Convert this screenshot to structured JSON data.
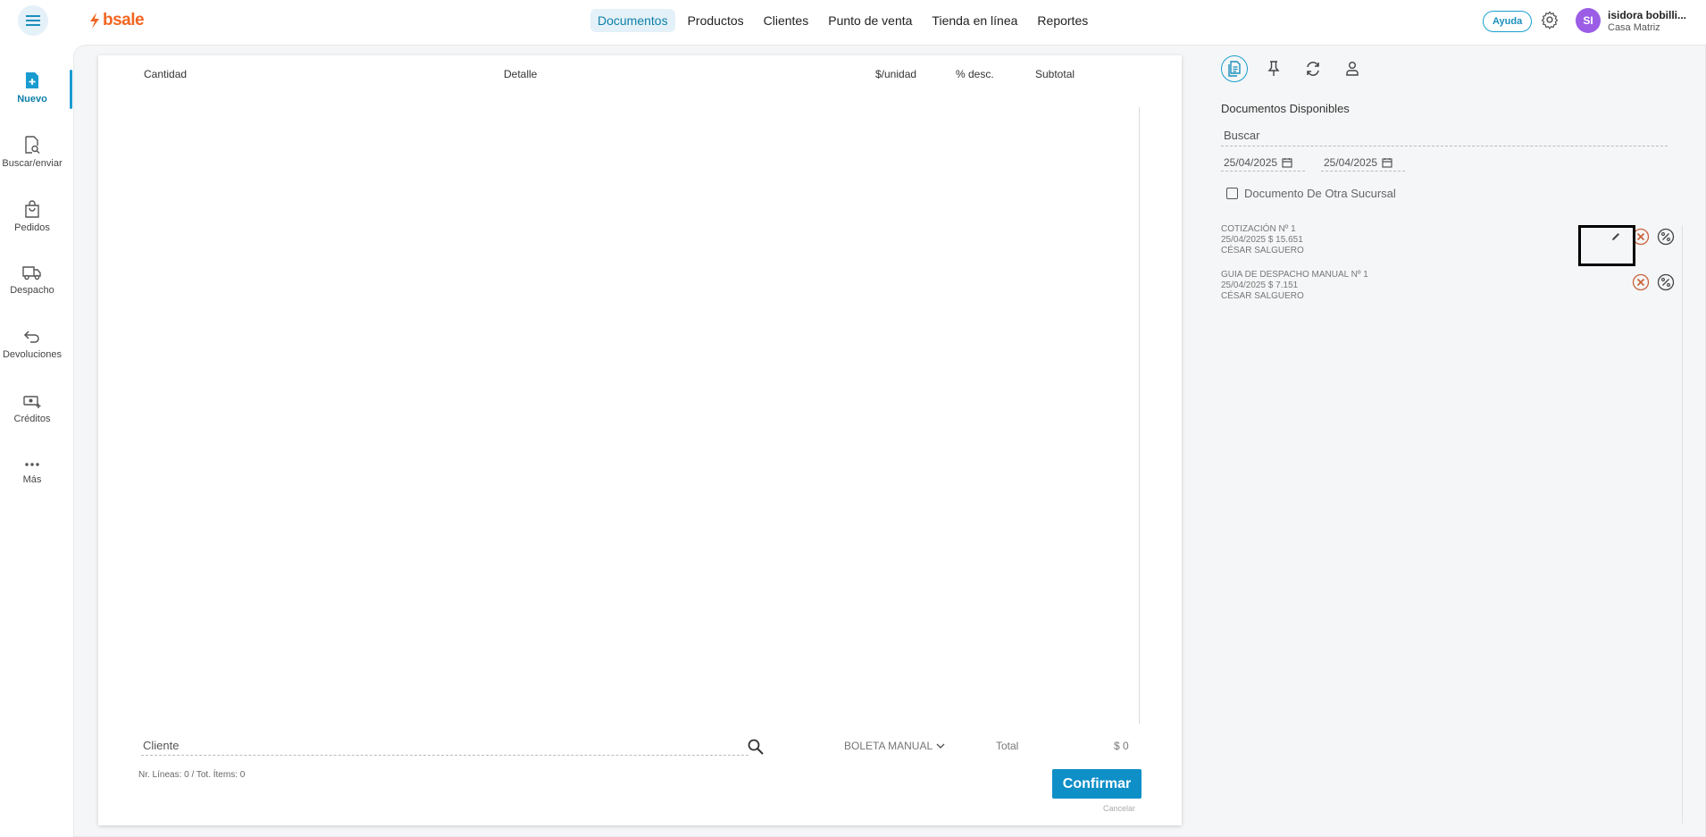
{
  "header": {
    "logo_text": "bsale",
    "nav": [
      {
        "label": "Documentos",
        "active": true
      },
      {
        "label": "Productos",
        "active": false
      },
      {
        "label": "Clientes",
        "active": false
      },
      {
        "label": "Punto de venta",
        "active": false
      },
      {
        "label": "Tienda en línea",
        "active": false
      },
      {
        "label": "Reportes",
        "active": false
      }
    ],
    "help_label": "Ayuda",
    "avatar_initials": "SI",
    "user_name": "isidora bobilli...",
    "user_branch": "Casa Matriz"
  },
  "sidebar": {
    "items": [
      {
        "label": "Nuevo",
        "icon": "new-document-icon",
        "active": true
      },
      {
        "label": "Buscar/enviar",
        "icon": "search-document-icon",
        "active": false
      },
      {
        "label": "Pedidos",
        "icon": "shopping-bag-icon",
        "active": false
      },
      {
        "label": "Despacho",
        "icon": "truck-icon",
        "active": false
      },
      {
        "label": "Devoluciones",
        "icon": "return-arrow-icon",
        "active": false
      },
      {
        "label": "Créditos",
        "icon": "cash-plus-icon",
        "active": false
      },
      {
        "label": "Más",
        "icon": "more-dots-icon",
        "active": false
      }
    ]
  },
  "table": {
    "headers": {
      "cantidad": "Cantidad",
      "detalle": "Detalle",
      "unidad": "$/unidad",
      "desc": "% desc.",
      "subtotal": "Subtotal"
    }
  },
  "footer": {
    "cliente_placeholder": "Cliente",
    "doc_type": "BOLETA MANUAL",
    "total_label": "Total",
    "total_value": "$ 0",
    "lines_info": "Nr. Líneas: 0 / Tot. Ítems: 0",
    "confirm_label": "Confirmar",
    "cancel_label": "Cancelar"
  },
  "right_panel": {
    "title": "Documentos Disponibles",
    "search_placeholder": "Buscar",
    "date_from": "25/04/2025",
    "date_to": "25/04/2025",
    "checkbox_label": "Documento De Otra Sucursal",
    "documents": [
      {
        "title": "COTIZACIÓN Nº 1",
        "info": "25/04/2025 $ 15.651",
        "client": "CÉSAR SALGUERO"
      },
      {
        "title": "GUIA DE DESPACHO MANUAL Nº 1",
        "info": "25/04/2025 $ 7.151",
        "client": "CÉSAR SALGUERO"
      }
    ]
  },
  "colors": {
    "brand": "#f26522",
    "accent": "#0e8fc7",
    "danger": "#c8643c"
  }
}
